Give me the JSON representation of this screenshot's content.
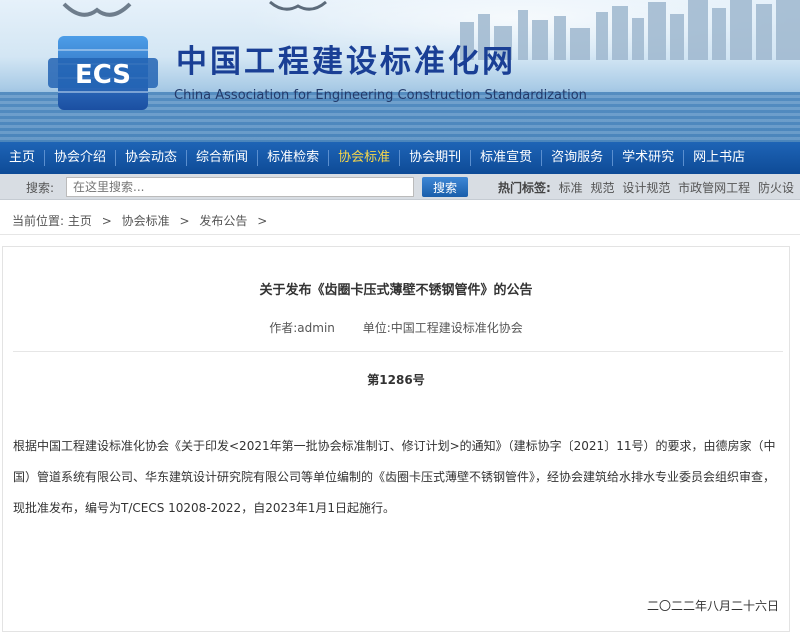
{
  "header": {
    "logo_text": "ECS",
    "title_cn": "中国工程建设标准化网",
    "title_en": "China Association for Engineering Construction Standardization"
  },
  "nav": {
    "items": [
      {
        "label": "主页"
      },
      {
        "label": "协会介绍"
      },
      {
        "label": "协会动态"
      },
      {
        "label": "综合新闻"
      },
      {
        "label": "标准检索"
      },
      {
        "label": "协会标准",
        "active": true
      },
      {
        "label": "协会期刊"
      },
      {
        "label": "标准宣贯"
      },
      {
        "label": "咨询服务"
      },
      {
        "label": "学术研究"
      },
      {
        "label": "网上书店"
      }
    ]
  },
  "search": {
    "label": "搜索:",
    "placeholder": "在这里搜索...",
    "button_label": "搜索",
    "hot_label": "热门标签:",
    "hot_tags": [
      "标准",
      "规范",
      "设计规范",
      "市政管网工程",
      "防火设"
    ]
  },
  "breadcrumb": {
    "prefix": "当前位置:",
    "items": [
      "主页",
      "协会标准",
      "发布公告"
    ],
    "separator": ">"
  },
  "article": {
    "title": "关于发布《齿圈卡压式薄壁不锈钢管件》的公告",
    "author": "作者:admin",
    "unit": "单位:中国工程建设标准化协会",
    "doc_number": "第1286号",
    "body": "根据中国工程建设标准化协会《关于印发<2021年第一批协会标准制订、修订计划>的通知》（建标协字〔2021〕11号）的要求，由德房家（中国）管道系统有限公司、华东建筑设计研究院有限公司等单位编制的《齿圈卡压式薄壁不锈钢管件》，经协会建筑给水排水专业委员会组织审查，现批准发布，编号为T/CECS 10208-2022，自2023年1月1日起施行。",
    "date": "二〇二二年八月二十六日"
  },
  "colors": {
    "nav_bg": "#15579f",
    "nav_active": "#f6d64a",
    "title_blue": "#1a3f95",
    "search_button": "#1a5eaa"
  }
}
